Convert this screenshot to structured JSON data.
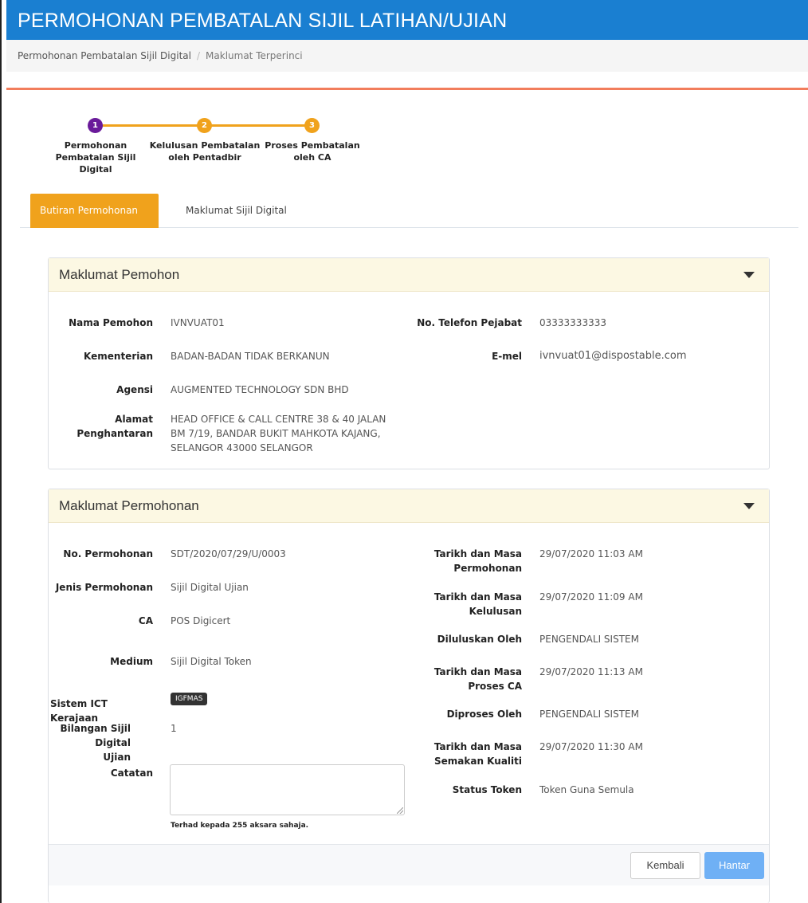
{
  "header": {
    "title": "PERMOHONAN PEMBATALAN SIJIL LATIHAN/UJIAN"
  },
  "breadcrumb": {
    "parent": "Permohonan Pembatalan Sijil Digital",
    "separator": "/",
    "current": "Maklumat Terperinci"
  },
  "stepper": {
    "steps": [
      {
        "number": "1",
        "label_line1": "Permohonan",
        "label_line2": "Pembatalan Sijil Digital",
        "color": "#6a1b9a"
      },
      {
        "number": "2",
        "label_line1": "Kelulusan Pembatalan",
        "label_line2": "oleh Pentadbir",
        "color": "#f0a21c"
      },
      {
        "number": "3",
        "label_line1": "Proses Pembatalan",
        "label_line2": "oleh CA",
        "color": "#f0a21c"
      }
    ]
  },
  "tabs": [
    {
      "label": "Butiran Permohonan",
      "active": true
    },
    {
      "label": "Maklumat Sijil Digital",
      "active": false
    }
  ],
  "pemohon": {
    "title": "Maklumat Pemohon",
    "nama_label": "Nama Pemohon",
    "nama_value": "IVNVUAT01",
    "kementerian_label": "Kementerian",
    "kementerian_value": "BADAN-BADAN TIDAK BERKANUN",
    "agensi_label": "Agensi",
    "agensi_value": "AUGMENTED TECHNOLOGY SDN BHD",
    "alamat_label_line1": "Alamat",
    "alamat_label_line2": "Penghantaran",
    "alamat_line1": "HEAD OFFICE & CALL CENTRE 38 & 40 JALAN",
    "alamat_line2": "BM 7/19, BANDAR BUKIT MAHKOTA KAJANG,",
    "alamat_line3": "SELANGOR 43000 SELANGOR",
    "telefon_label": "No. Telefon Pejabat",
    "telefon_value": "03333333333",
    "emel_label": "E-mel",
    "emel_value": "ivnvuat01@dispostable.com"
  },
  "permohonan": {
    "title": "Maklumat Permohonan",
    "no_label": "No. Permohonan",
    "no_value": "SDT/2020/07/29/U/0003",
    "jenis_label": "Jenis Permohonan",
    "jenis_value": "Sijil Digital Ujian",
    "ca_label": "CA",
    "ca_value": "POS Digicert",
    "medium_label": "Medium",
    "medium_value": "Sijil Digital Token",
    "sistem_label": "Sistem ICT Kerajaan",
    "sistem_badge": "IGFMAS",
    "bilangan_label_line1": "Bilangan Sijil Digital",
    "bilangan_label_line2": "Ujian",
    "bilangan_value": "1",
    "catatan_label": "Catatan",
    "catatan_value": "",
    "catatan_help": "Terhad kepada 255 aksara sahaja.",
    "tarikh_permohonan_label_line1": "Tarikh dan Masa",
    "tarikh_permohonan_label_line2": "Permohonan",
    "tarikh_permohonan_value": "29/07/2020 11:03 AM",
    "tarikh_kelulusan_label_line1": "Tarikh dan Masa",
    "tarikh_kelulusan_label_line2": "Kelulusan",
    "tarikh_kelulusan_value": "29/07/2020 11:09 AM",
    "diluluskan_label": "Diluluskan Oleh",
    "diluluskan_value": "PENGENDALI SISTEM",
    "tarikh_proses_label_line1": "Tarikh dan Masa",
    "tarikh_proses_label_line2": "Proses CA",
    "tarikh_proses_value": "29/07/2020 11:13 AM",
    "diproses_label": "Diproses Oleh",
    "diproses_value": "PENGENDALI SISTEM",
    "tarikh_semakan_label_line1": "Tarikh dan Masa",
    "tarikh_semakan_label_line2": "Semakan Kualiti",
    "tarikh_semakan_value": "29/07/2020 11:30 AM",
    "status_label": "Status Token",
    "status_value": "Token Guna Semula"
  },
  "actions": {
    "back_label": "Kembali",
    "submit_label": "Hantar"
  }
}
